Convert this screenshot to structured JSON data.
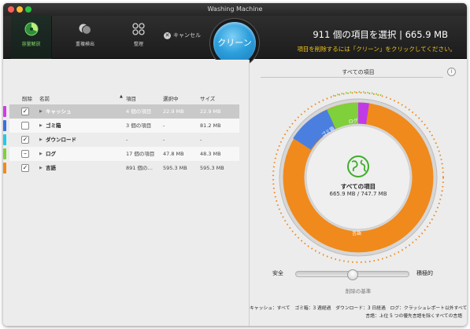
{
  "window": {
    "title": "Washing Machine"
  },
  "toolbar": {
    "tools": [
      {
        "label": "容量解放",
        "icon": "disk-space-icon"
      },
      {
        "label": "重複検出",
        "icon": "duplicates-icon"
      },
      {
        "label": "整理",
        "icon": "organize-icon"
      }
    ],
    "cancel_label": "キャンセル",
    "clean_label": "クリーン"
  },
  "summary": {
    "title": "911 個の項目を選択 | 665.9 MB",
    "subtitle": "項目を削除するには「クリーン」をクリックしてください。"
  },
  "table": {
    "headers": {
      "delete": "削除",
      "name": "名前",
      "items": "項目",
      "selected": "選択中",
      "size": "サイズ"
    },
    "rows": [
      {
        "name": "キャッシュ",
        "items": "4 個の項目",
        "selected": "22.9 MB",
        "size": "22.9 MB",
        "checked": "✓",
        "color": "#d03be6"
      },
      {
        "name": "ゴミ箱",
        "items": "3 個の項目",
        "selected": "-",
        "size": "81.2 MB",
        "checked": "",
        "color": "#3a6fe0"
      },
      {
        "name": "ダウンロード",
        "items": "-",
        "selected": "-",
        "size": "-",
        "checked": "✓",
        "color": "#26c9e4"
      },
      {
        "name": "ログ",
        "items": "17 個の項目",
        "selected": "47.8 MB",
        "size": "48.3 MB",
        "checked": "–",
        "color": "#7fd03a"
      },
      {
        "name": "言語",
        "items": "891 個の…",
        "selected": "595.3 MB",
        "size": "595.3 MB",
        "checked": "✓",
        "color": "#f08a1c"
      }
    ]
  },
  "chart": {
    "section_title": "すべての項目",
    "info_label": "i",
    "center_title": "すべての項目",
    "center_value": "665.9 MB / 747.7 MB",
    "center_icon": "globe-icon",
    "segments": [
      {
        "label": "言語",
        "color": "#f08a1c"
      },
      {
        "label": "ゴミ箱",
        "color": "#4a7fe0"
      },
      {
        "label": "ログ",
        "color": "#7fd03a"
      },
      {
        "label": "",
        "color": "#c03be6"
      }
    ]
  },
  "slider": {
    "left_label": "安全",
    "right_label": "積極的",
    "caption": "削除の基準",
    "value_fraction": 0.5
  },
  "legend": {
    "line1": "キャッシュ：すべて　ゴミ箱：3 週経過　ダウンロード：3 日経過　ログ：クラッシュレポート以外すべて",
    "line2": "言語：上位 5 つの優先言語を除くすべての言語"
  }
}
